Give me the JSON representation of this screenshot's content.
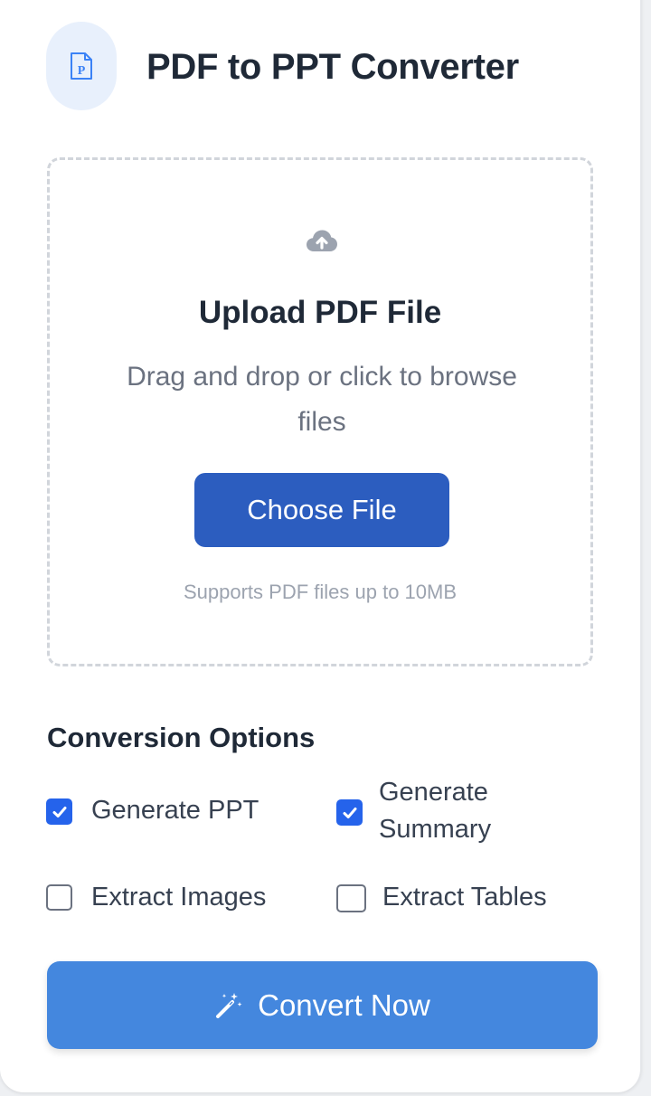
{
  "header": {
    "title": "PDF to PPT Converter",
    "icon": "pdf-file-icon",
    "icon_letter": "P"
  },
  "upload": {
    "icon": "cloud-upload-icon",
    "title": "Upload PDF File",
    "description": "Drag and drop or click to browse files",
    "button_label": "Choose File",
    "support_text": "Supports PDF files up to 10MB"
  },
  "options": {
    "title": "Conversion Options",
    "items": [
      {
        "label": "Generate PPT",
        "checked": true
      },
      {
        "label": "Generate Summary",
        "checked": true
      },
      {
        "label": "Extract Images",
        "checked": false
      },
      {
        "label": "Extract Tables",
        "checked": false
      }
    ]
  },
  "convert": {
    "label": "Convert Now",
    "icon": "magic-wand-icon"
  },
  "colors": {
    "primary": "#2c5dbf",
    "convert": "#4487de",
    "checkbox": "#2563eb",
    "icon_bg": "#e8f0fc"
  }
}
